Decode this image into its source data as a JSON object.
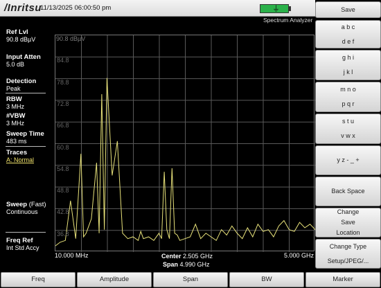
{
  "header": {
    "brand": "/Inritsu",
    "datetime": "11/13/2025 06:00:50 pm",
    "mode": "Spectrum Analyzer",
    "battery_icon": "battery-icon",
    "plug_icon": "plug-icon"
  },
  "left_panel": {
    "ref_lvl": {
      "title": "Ref Lvl",
      "value": "90.8 dBµV"
    },
    "input_atten": {
      "title": "Input Atten",
      "value": "5.0 dB"
    },
    "detection": {
      "title": "Detection",
      "value": "Peak"
    },
    "rbw": {
      "title": "RBW",
      "value": "3 MHz"
    },
    "vbw": {
      "title": "#VBW",
      "value": "3 MHz"
    },
    "sweep_time": {
      "title": "Sweep Time",
      "value": "483 ms"
    },
    "traces": {
      "title": "Traces",
      "value": "A: Normal"
    },
    "sweep": {
      "title": "Sweep",
      "qualifier": "(Fast)",
      "value": "Continuous"
    },
    "freq_ref": {
      "title": "Freq Ref",
      "value": "Int Std Accy"
    }
  },
  "softkeys": [
    {
      "lines": [
        "Save"
      ]
    },
    {
      "lines": [
        "a b c",
        "d e f"
      ]
    },
    {
      "lines": [
        "g h i",
        "j k l"
      ]
    },
    {
      "lines": [
        "m n o",
        "p q r"
      ]
    },
    {
      "lines": [
        "s t u",
        "v w x"
      ]
    },
    {
      "lines": [
        "y z - _ +"
      ]
    },
    {
      "lines": [
        "Back Space"
      ]
    },
    {
      "lines": [
        "Change",
        "Save",
        "Location"
      ]
    },
    {
      "lines": [
        "Change Type",
        "Setup/JPEG/..."
      ]
    }
  ],
  "bottom_menu": [
    "Freq",
    "Amplitude",
    "Span",
    "BW",
    "Marker"
  ],
  "chart_data": {
    "type": "line",
    "ref_label": "90.8 dBµV",
    "y_ticks": [
      "84.8",
      "78.8",
      "72.8",
      "66.8",
      "60.8",
      "54.8",
      "48.8",
      "42.8",
      "36.8"
    ],
    "ylim": [
      30.8,
      90.8
    ],
    "x_start_label": "10.000 MHz",
    "x_stop_label": "5.000 GHz",
    "center_label": "Center",
    "center_value": "2.505 GHz",
    "span_label": "Span",
    "span_value": "4.990 GHz",
    "xlim": [
      0.01,
      5.0
    ],
    "grid": true,
    "trace_color": "#e8e27a",
    "series": [
      {
        "x": [
          0.01,
          0.1,
          0.2,
          0.3,
          0.4,
          0.5,
          0.55,
          0.6,
          0.7,
          0.8,
          0.85,
          0.9,
          0.95,
          1.0,
          1.1,
          1.2,
          1.3,
          1.4,
          1.5,
          1.6,
          1.65,
          1.7,
          1.8,
          1.9,
          2.0,
          2.05,
          2.1,
          2.15,
          2.2,
          2.25,
          2.3,
          2.35,
          2.4,
          2.5,
          2.6,
          2.7,
          2.8,
          2.9,
          3.0,
          3.1,
          3.2,
          3.3,
          3.4,
          3.5,
          3.6,
          3.7,
          3.8,
          3.9,
          4.0,
          4.1,
          4.2,
          4.3,
          4.4,
          4.5,
          4.6,
          4.7,
          4.8,
          4.9,
          5.0
        ],
        "y": [
          32.5,
          33.5,
          34.0,
          45.0,
          34.5,
          58.0,
          35.0,
          36.0,
          40.0,
          55.5,
          36.0,
          74.5,
          37.0,
          79.0,
          52.0,
          61.5,
          36.0,
          34.5,
          35.0,
          34.0,
          36.5,
          34.5,
          35.0,
          34.0,
          36.0,
          34.5,
          53.0,
          37.0,
          34.5,
          54.0,
          36.0,
          35.5,
          34.0,
          34.5,
          35.0,
          38.5,
          34.5,
          36.0,
          35.0,
          34.0,
          37.0,
          35.5,
          38.0,
          36.0,
          34.5,
          37.5,
          35.0,
          38.5,
          36.5,
          37.0,
          35.0,
          38.0,
          39.5,
          37.0,
          36.5,
          39.0,
          37.5,
          38.5,
          37.0
        ]
      }
    ]
  }
}
